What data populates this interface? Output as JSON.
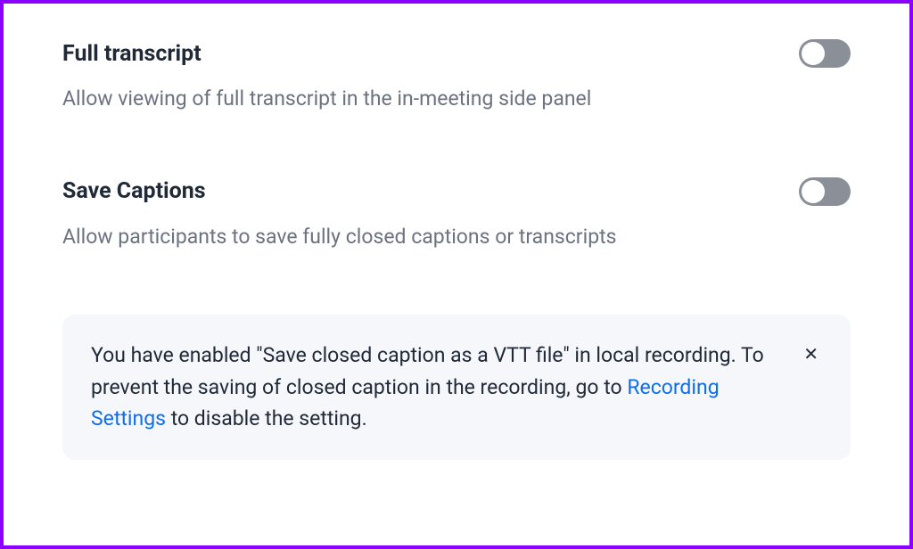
{
  "settings": [
    {
      "title": "Full transcript",
      "description": "Allow viewing of full transcript in the in-meeting side panel",
      "toggle": false
    },
    {
      "title": "Save Captions",
      "description": "Allow participants to save fully closed captions or transcripts",
      "toggle": false
    }
  ],
  "info_box": {
    "text_before_link": "You have enabled \"Save closed caption as a VTT file\" in local recording. To prevent the saving of closed caption in the recording, go to ",
    "link_text": "Recording Settings",
    "text_after_link": " to disable the setting."
  }
}
